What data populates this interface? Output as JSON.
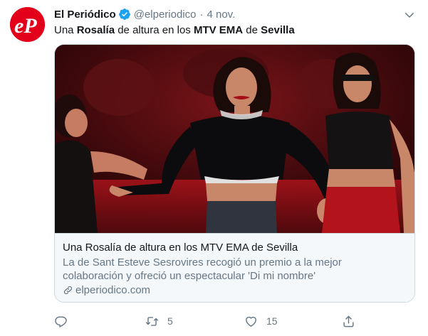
{
  "author": {
    "name": "El Periódico",
    "handle": "@elperiodico",
    "separator": "·",
    "time": "4 nov.",
    "avatar_text": "eP",
    "verified": true
  },
  "tweet": {
    "text_parts": [
      "Una ",
      "Rosalía",
      " de altura en los ",
      "MTV EMA",
      " de ",
      "Sevilla"
    ]
  },
  "card": {
    "title": "Una Rosalía de altura en los MTV EMA de Sevilla",
    "description": "La de Sant Esteve Sesrovires recogió un premio a la mejor colaboración y ofreció un espectacular 'Di mi nombre'",
    "domain": "elperiodico.com"
  },
  "actions": {
    "reply_count": "",
    "retweet_count": "5",
    "like_count": "15"
  },
  "icons": {
    "menu": "chevron-down-icon",
    "verified": "verified-badge-icon",
    "link": "link-icon",
    "reply": "reply-icon",
    "retweet": "retweet-icon",
    "like": "heart-icon",
    "share": "share-icon"
  },
  "colors": {
    "brand": "#e2001a",
    "verified": "#1da1f2",
    "text": "#14171a",
    "secondary": "#657786",
    "card_bg": "#f5f8fa",
    "border": "#cfd9de"
  }
}
